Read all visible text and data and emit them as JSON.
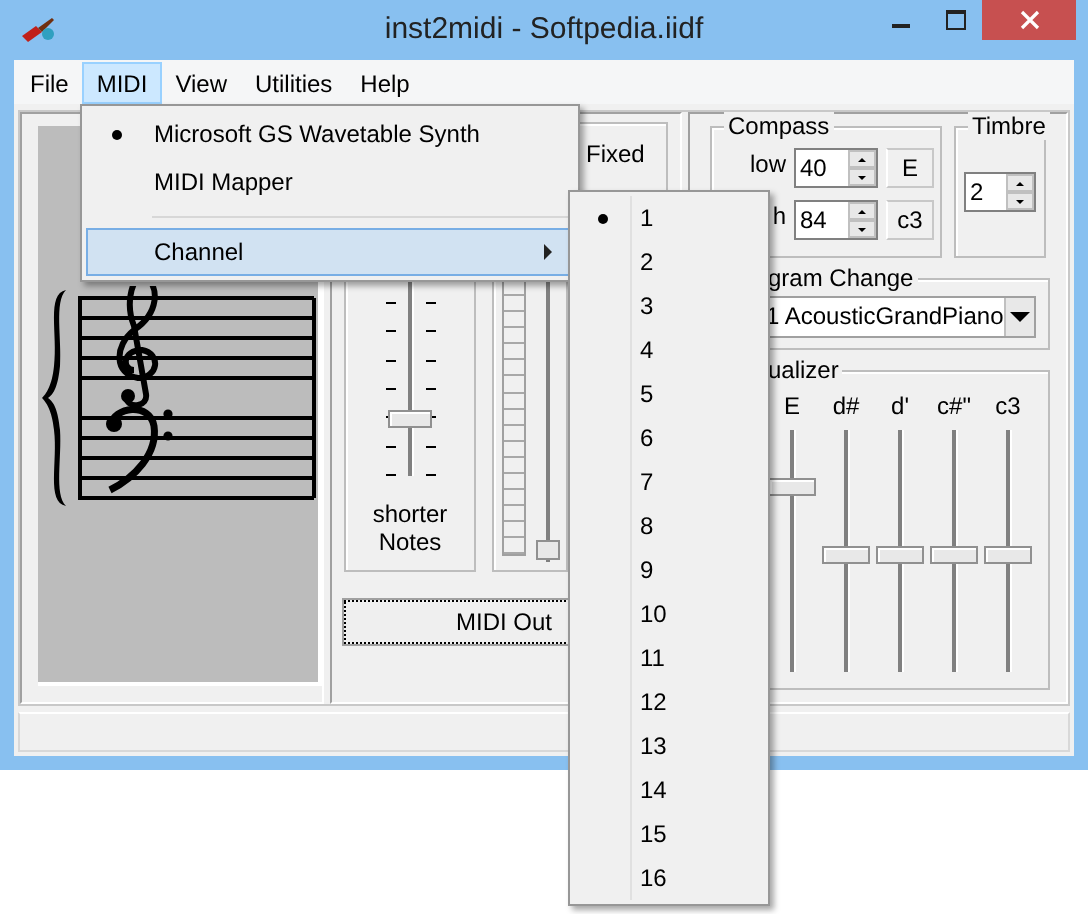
{
  "window": {
    "title": "inst2midi - Softpedia.iidf"
  },
  "menu_bar": [
    {
      "label": "File",
      "selected": false
    },
    {
      "label": "MIDI",
      "selected": true
    },
    {
      "label": "View",
      "selected": false
    },
    {
      "label": "Utilities",
      "selected": false
    },
    {
      "label": "Help",
      "selected": false
    }
  ],
  "midi_menu": [
    {
      "kind": "radio",
      "label": "Microsoft GS Wavetable Synth",
      "checked": true
    },
    {
      "kind": "radio",
      "label": "MIDI Mapper",
      "checked": false
    },
    {
      "kind": "separator"
    },
    {
      "kind": "submenu",
      "label": "Channel",
      "selected": true
    }
  ],
  "channel_menu": [
    {
      "label": "1",
      "checked": true
    },
    {
      "label": "2",
      "checked": false
    },
    {
      "label": "3",
      "checked": false
    },
    {
      "label": "4",
      "checked": false
    },
    {
      "label": "5",
      "checked": false
    },
    {
      "label": "6",
      "checked": false
    },
    {
      "label": "7",
      "checked": false
    },
    {
      "label": "8",
      "checked": false
    },
    {
      "label": "9",
      "checked": false
    },
    {
      "label": "10",
      "checked": false
    },
    {
      "label": "11",
      "checked": false
    },
    {
      "label": "12",
      "checked": false
    },
    {
      "label": "13",
      "checked": false
    },
    {
      "label": "14",
      "checked": false
    },
    {
      "label": "15",
      "checked": false
    },
    {
      "label": "16",
      "checked": false
    }
  ],
  "length_slider": {
    "level": 0.25,
    "caption": "shorter Notes"
  },
  "mode": {
    "option": "Fixed"
  },
  "meter_slider": {
    "level": 0.04
  },
  "midi_out_button": "MIDI Out",
  "compass": {
    "title": "Compass",
    "rows": [
      {
        "label": "low",
        "value": "40",
        "note": "E"
      },
      {
        "label": "h",
        "value": "84",
        "note": "c3"
      }
    ]
  },
  "timbre": {
    "title": "Timbre",
    "value": "2"
  },
  "program_change": {
    "title": "gram Change",
    "value": "1 AcousticGrandPiano"
  },
  "equalizer": {
    "title": "ualizer",
    "bands": [
      {
        "label": "E",
        "level": 0.77
      },
      {
        "label": "d#",
        "level": 0.49
      },
      {
        "label": "d'",
        "level": 0.49
      },
      {
        "label": "c#\"",
        "level": 0.49
      },
      {
        "label": "c3",
        "level": 0.49
      }
    ]
  }
}
